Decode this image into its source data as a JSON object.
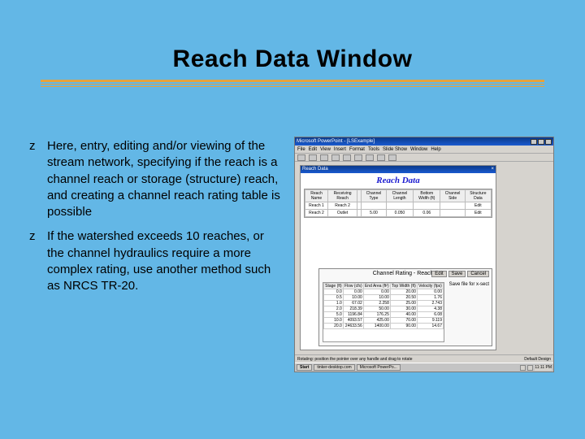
{
  "title": "Reach Data Window",
  "bullets": [
    "Here, entry, editing and/or viewing of the stream network, specifying if the reach is a channel reach or storage (structure) reach, and creating a channel reach rating table is possible",
    "If the watershed exceeds 10 reaches, or the channel hydraulics require a more complex rating, use another method such as NRCS TR-20."
  ],
  "screenshot": {
    "app_title": "Microsoft PowerPoint - [LSExample]",
    "menubar": [
      "File",
      "Edit",
      "View",
      "Insert",
      "Format",
      "Tools",
      "Slide Show",
      "Window",
      "Help"
    ],
    "inner_title": "Reach Data",
    "panel_heading": "Reach Data",
    "grid1": {
      "headers": [
        "Reach Name",
        "Receiving Reach",
        "",
        "Channel Type",
        "Channel Length",
        "Bottom Width (ft)",
        "Channel Side",
        "Structure Data"
      ],
      "rows": [
        [
          "Reach 1",
          "Reach 2",
          "",
          "",
          "",
          "",
          "",
          "Edit"
        ],
        [
          "Reach 2",
          "Outlet",
          "",
          "5.00",
          "0.050",
          "0.06",
          "",
          "Edit"
        ]
      ]
    },
    "panel": {
      "title": "Channel Rating - Reach 2",
      "buttons_top": [
        "Edit",
        "Save",
        "Cancel"
      ],
      "button_side": "Save file for x-sect",
      "table": {
        "headers": [
          "Stage (ft)",
          "Flow (cfs)",
          "End Area (ft²)",
          "Top Width (ft)",
          "Velocity (fps)"
        ],
        "rows": [
          [
            "0.0",
            "0.00",
            "0.00",
            "20.00",
            "0.00"
          ],
          [
            "0.5",
            "10.00",
            "10.00",
            "20.50",
            "1.76"
          ],
          [
            "1.0",
            "67.02",
            "2.258",
            "25.00",
            "2.743"
          ],
          [
            "2.0",
            "218.39",
            "50.00",
            "30.00",
            "4.38"
          ],
          [
            "5.0",
            "1196.84",
            "176.25",
            "40.00",
            "6.08"
          ],
          [
            "10.0",
            "4093.57",
            "425.00",
            "70.00",
            "9.119"
          ],
          [
            "20.0",
            "24633.56",
            "1400.00",
            "90.00",
            "14.67"
          ]
        ]
      }
    },
    "status_left": "Rotating: position the pointer over any handle and drag to rotate",
    "status_right": "Default Design",
    "taskbar": {
      "start": "Start",
      "tasks": [
        "tinker-desktop.com",
        "",
        "Microsoft PowerPo..."
      ],
      "clock": "11:11 PM"
    }
  }
}
